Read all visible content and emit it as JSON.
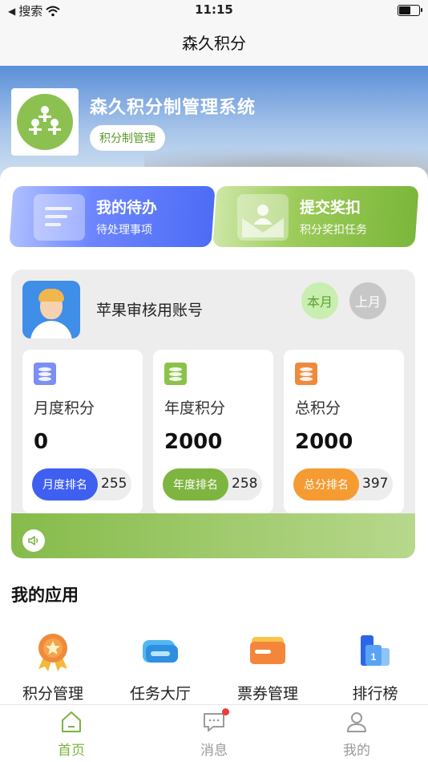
{
  "status_bar": {
    "back_app": "搜索",
    "time": "11:15",
    "battery_level": 0.6
  },
  "nav": {
    "title": "森久积分"
  },
  "hero": {
    "system_title": "森久积分制管理系统",
    "tag": "积分制管理"
  },
  "actions": [
    {
      "title": "我的待办",
      "subtitle": "待处理事项",
      "color": "#5b78f7"
    },
    {
      "title": "提交奖扣",
      "subtitle": "积分奖扣任务",
      "color": "#84bb41"
    }
  ],
  "user": {
    "name": "苹果审核用账号",
    "period_current": "本月",
    "period_previous": "上月"
  },
  "stats": [
    {
      "label": "月度积分",
      "value": "0",
      "rank_label": "月度排名",
      "rank": "255",
      "color": "#3f5ff0",
      "icon_color": "#7b8ff5"
    },
    {
      "label": "年度积分",
      "value": "2000",
      "rank_label": "年度排名",
      "rank": "258",
      "color": "#7eb540",
      "icon_color": "#8bc34a"
    },
    {
      "label": "总积分",
      "value": "2000",
      "rank_label": "总分排名",
      "rank": "397",
      "color": "#f59b32",
      "icon_color": "#f08a3b"
    }
  ],
  "apps": {
    "section_title": "我的应用",
    "items": [
      {
        "label": "积分管理",
        "icon": "medal-icon"
      },
      {
        "label": "任务大厅",
        "icon": "vr-glasses-icon"
      },
      {
        "label": "票券管理",
        "icon": "ticket-card-icon"
      },
      {
        "label": "排行榜",
        "icon": "ranking-icon"
      }
    ]
  },
  "tabs": [
    {
      "label": "首页",
      "icon": "home-icon",
      "active": true
    },
    {
      "label": "消息",
      "icon": "message-icon",
      "active": false,
      "badge": true
    },
    {
      "label": "我的",
      "icon": "user-icon",
      "active": false
    }
  ],
  "colors": {
    "accent_green": "#7cb342",
    "accent_blue": "#4d6cf5"
  }
}
